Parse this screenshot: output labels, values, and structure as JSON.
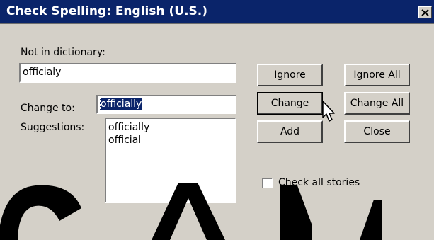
{
  "window": {
    "title": "Check Spelling: English (U.S.)",
    "close_glyph": "✕"
  },
  "not_in_dictionary": {
    "label": "Not in dictionary:",
    "value": "officialy"
  },
  "change_to": {
    "label": "Change to:",
    "value": "officially"
  },
  "suggestions": {
    "label": "Suggestions:",
    "items": [
      "officially",
      "official"
    ]
  },
  "buttons": {
    "ignore": "Ignore",
    "ignore_all": "Ignore All",
    "change": "Change",
    "change_all": "Change All",
    "add": "Add",
    "close": "Close"
  },
  "options": {
    "check_all_stories_label": "Check all stories",
    "check_all_stories_checked": false
  },
  "colors": {
    "title_bar": "#0a246a",
    "dialog_face": "#d4d0c8",
    "selection": "#0a246a"
  }
}
